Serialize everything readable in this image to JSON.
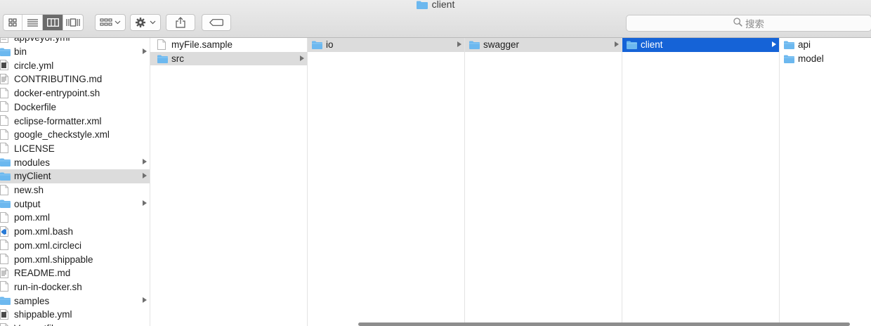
{
  "window": {
    "title": "client"
  },
  "search": {
    "placeholder": "搜索"
  },
  "columns": [
    {
      "rows": [
        {
          "name": "appveyor.yml",
          "type": "doc"
        },
        {
          "name": "bin",
          "type": "folder",
          "arrow": true
        },
        {
          "name": "circle.yml",
          "type": "dark"
        },
        {
          "name": "CONTRIBUTING.md",
          "type": "text"
        },
        {
          "name": "docker-entrypoint.sh",
          "type": "file"
        },
        {
          "name": "Dockerfile",
          "type": "file"
        },
        {
          "name": "eclipse-formatter.xml",
          "type": "file"
        },
        {
          "name": "google_checkstyle.xml",
          "type": "file"
        },
        {
          "name": "LICENSE",
          "type": "file"
        },
        {
          "name": "modules",
          "type": "folder",
          "arrow": true
        },
        {
          "name": "myClient",
          "type": "folder",
          "arrow": true,
          "state": "hl"
        },
        {
          "name": "new.sh",
          "type": "file"
        },
        {
          "name": "output",
          "type": "folder",
          "arrow": true
        },
        {
          "name": "pom.xml",
          "type": "file"
        },
        {
          "name": "pom.xml.bash",
          "type": "vscode"
        },
        {
          "name": "pom.xml.circleci",
          "type": "file"
        },
        {
          "name": "pom.xml.shippable",
          "type": "file"
        },
        {
          "name": "README.md",
          "type": "text"
        },
        {
          "name": "run-in-docker.sh",
          "type": "file"
        },
        {
          "name": "samples",
          "type": "folder",
          "arrow": true
        },
        {
          "name": "shippable.yml",
          "type": "dark"
        },
        {
          "name": "Vagrantfile",
          "type": "file"
        }
      ]
    },
    {
      "rows": [
        {
          "name": "myFile.sample",
          "type": "file"
        },
        {
          "name": "src",
          "type": "folder",
          "arrow": true,
          "state": "hl"
        }
      ]
    },
    {
      "rows": [
        {
          "name": "io",
          "type": "folder",
          "arrow": true,
          "state": "hl"
        }
      ]
    },
    {
      "rows": [
        {
          "name": "swagger",
          "type": "folder",
          "arrow": true,
          "state": "hl"
        }
      ]
    },
    {
      "rows": [
        {
          "name": "client",
          "type": "folder",
          "arrow": true,
          "state": "sel"
        }
      ]
    },
    {
      "rows": [
        {
          "name": "api",
          "type": "folder"
        },
        {
          "name": "model",
          "type": "folder"
        }
      ]
    }
  ],
  "colors": {
    "selection": "#1563d7",
    "highlight": "#dcdcdc",
    "folder": "#6cb8ef"
  },
  "icons": [
    "icon-view-button",
    "list-view-button",
    "column-view-button",
    "cover-flow-button",
    "arrange-button",
    "action-gear-button",
    "share-button",
    "tag-button",
    "search-icon",
    "folder-icon",
    "document-icon"
  ]
}
